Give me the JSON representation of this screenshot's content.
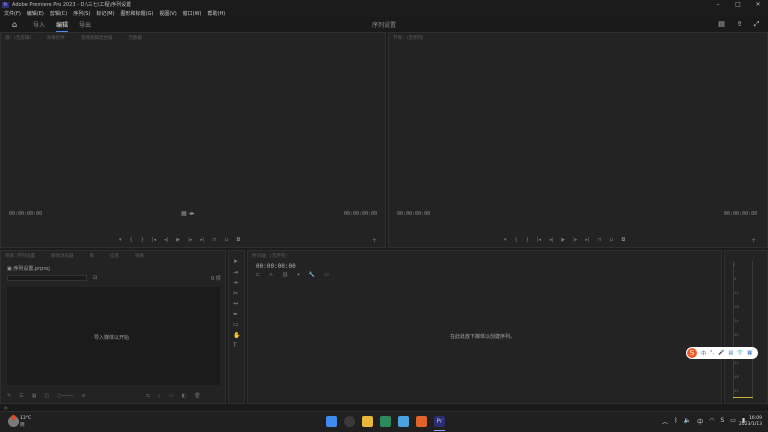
{
  "titlebar": {
    "app_icon": "Pr",
    "title": "Adobe Premiere Pro 2023 - D:\\三七\\工程\\序列设置",
    "min": "–",
    "max": "□",
    "close": "✕"
  },
  "menu": [
    "文件(F)",
    "编辑(E)",
    "剪辑(C)",
    "序列(S)",
    "标记(M)",
    "图形和标题(G)",
    "视图(V)",
    "窗口(W)",
    "帮助(H)"
  ],
  "workspace": {
    "tabs": [
      "导入",
      "编辑",
      "导出"
    ],
    "active": "编辑",
    "center_title": "序列设置"
  },
  "source_monitor": {
    "tabs": [
      "源：(无剪辑)",
      "效果控件",
      "音频剪辑混合器",
      "元数据"
    ],
    "tc_left": "00:00:00:00",
    "tc_right": "00:00:00:00"
  },
  "program_monitor": {
    "tabs": [
      "节目：(无序列)"
    ],
    "tc_left": "00:00:00:00",
    "tc_right": "00:00:00:00"
  },
  "project": {
    "tabs": [
      "项目: 序列设置",
      "媒体浏览器",
      "库",
      "信息",
      "效果"
    ],
    "name": "序列设置.prproj",
    "count": "0 项",
    "empty_text": "导入媒体以开始"
  },
  "timeline": {
    "tabs": [
      "时间轴：(无序列)"
    ],
    "timecode": "00:00:00:00",
    "empty_text": "在此处放下媒体以创建序列。"
  },
  "meter_ticks": [
    "0",
    "-6",
    "-12",
    "-18",
    "-24",
    "-30",
    "-36",
    "-42",
    "-48",
    "-54"
  ],
  "taskbar": {
    "weather_temp": "13°C",
    "weather_desc": "阴",
    "time": "16:09",
    "date": "2023/1/13"
  },
  "ime": {
    "label": "中"
  }
}
